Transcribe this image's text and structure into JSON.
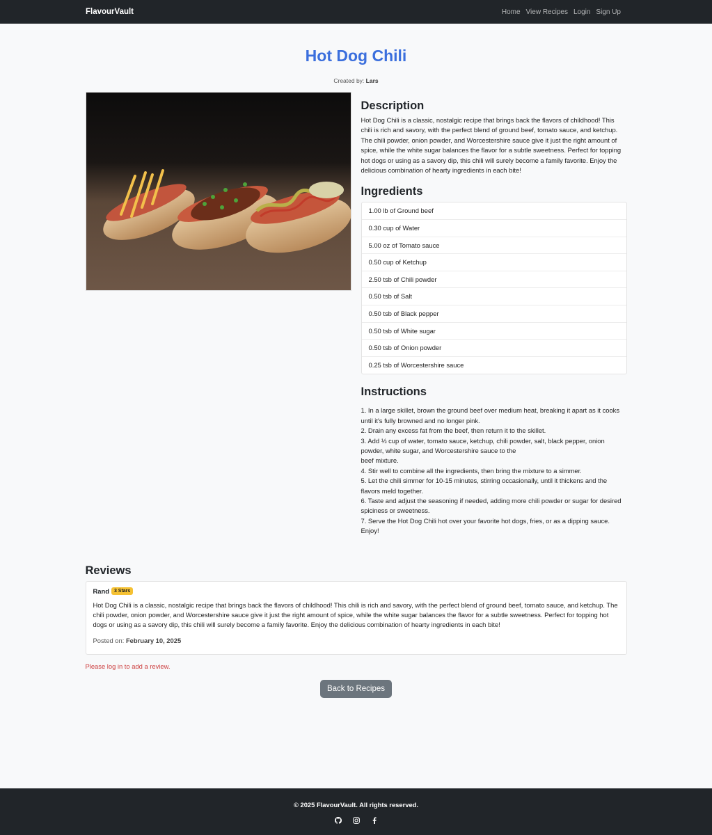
{
  "navbar": {
    "brand": "FlavourVault",
    "links": [
      "Home",
      "View Recipes",
      "Login",
      "Sign Up"
    ]
  },
  "recipe": {
    "title": "Hot Dog Chili",
    "created_by_label": "Created by:",
    "author": "Lars",
    "image_alt": "hot dogs with chili and toppings",
    "description_heading": "Description",
    "description": "Hot Dog Chili is a classic, nostalgic recipe that brings back the flavors of childhood! This chili is rich and savory, with the perfect blend of ground beef, tomato sauce, and ketchup. The chili powder, onion powder, and Worcestershire sauce give it just the right amount of spice, while the white sugar balances the flavor for a subtle sweetness. Perfect for topping hot dogs or using as a savory dip, this chili will surely become a family favorite. Enjoy the delicious combination of hearty ingredients in each bite!",
    "ingredients_heading": "Ingredients",
    "ingredients": [
      "1.00 lb of Ground beef",
      "0.30 cup of Water",
      "5.00 oz of Tomato sauce",
      "0.50 cup of Ketchup",
      "2.50 tsb of Chili powder",
      "0.50 tsb of Salt",
      "0.50 tsb of Black pepper",
      "0.50 tsb of White sugar",
      "0.50 tsb of Onion powder",
      "0.25 tsb of Worcestershire sauce"
    ],
    "instructions_heading": "Instructions",
    "instructions": "1. In a large skillet, brown the ground beef over medium heat, breaking it apart as it cooks until it's fully browned and no longer pink.\n2. Drain any excess fat from the beef, then return it to the skillet.\n3. Add ⅓ cup of water, tomato sauce, ketchup, chili powder, salt, black pepper, onion powder, white sugar, and Worcestershire sauce to the\nbeef mixture.\n4. Stir well to combine all the ingredients, then bring the mixture to a simmer.\n5. Let the chili simmer for 10-15 minutes, stirring occasionally, until it thickens and the flavors meld together.\n6. Taste and adjust the seasoning if needed, adding more chili powder or sugar for desired spiciness or sweetness.\n7. Serve the Hot Dog Chili hot over your favorite hot dogs, fries, or as a dipping sauce. Enjoy!"
  },
  "reviews": {
    "heading": "Reviews",
    "items": [
      {
        "author": "Rand",
        "rating_badge": "3 Stars",
        "text": "Hot Dog Chili is a classic, nostalgic recipe that brings back the flavors of childhood! This chili is rich and savory, with the perfect blend of ground beef, tomato sauce, and ketchup. The chili powder, onion powder, and Worcestershire sauce give it just the right amount of spice, while the white sugar balances the flavor for a subtle sweetness. Perfect for topping hot dogs or using as a savory dip, this chili will surely become a family favorite. Enjoy the delicious combination of hearty ingredients in each bite!",
        "posted_label": "Posted on:",
        "posted_date": "February 10, 2025"
      }
    ],
    "login_note": "Please log in to add a review."
  },
  "back_button": "Back to Recipes",
  "footer": {
    "copyright": "© 2025 FlavourVault. All rights reserved.",
    "social_icons": [
      "github-icon",
      "instagram-icon",
      "facebook-icon"
    ]
  },
  "colors": {
    "title_blue": "#3b6fdd",
    "nav_dark": "#212529",
    "badge_yellow": "#f5c133",
    "error_red": "#cc3b3b",
    "button_gray": "#6c757d"
  }
}
